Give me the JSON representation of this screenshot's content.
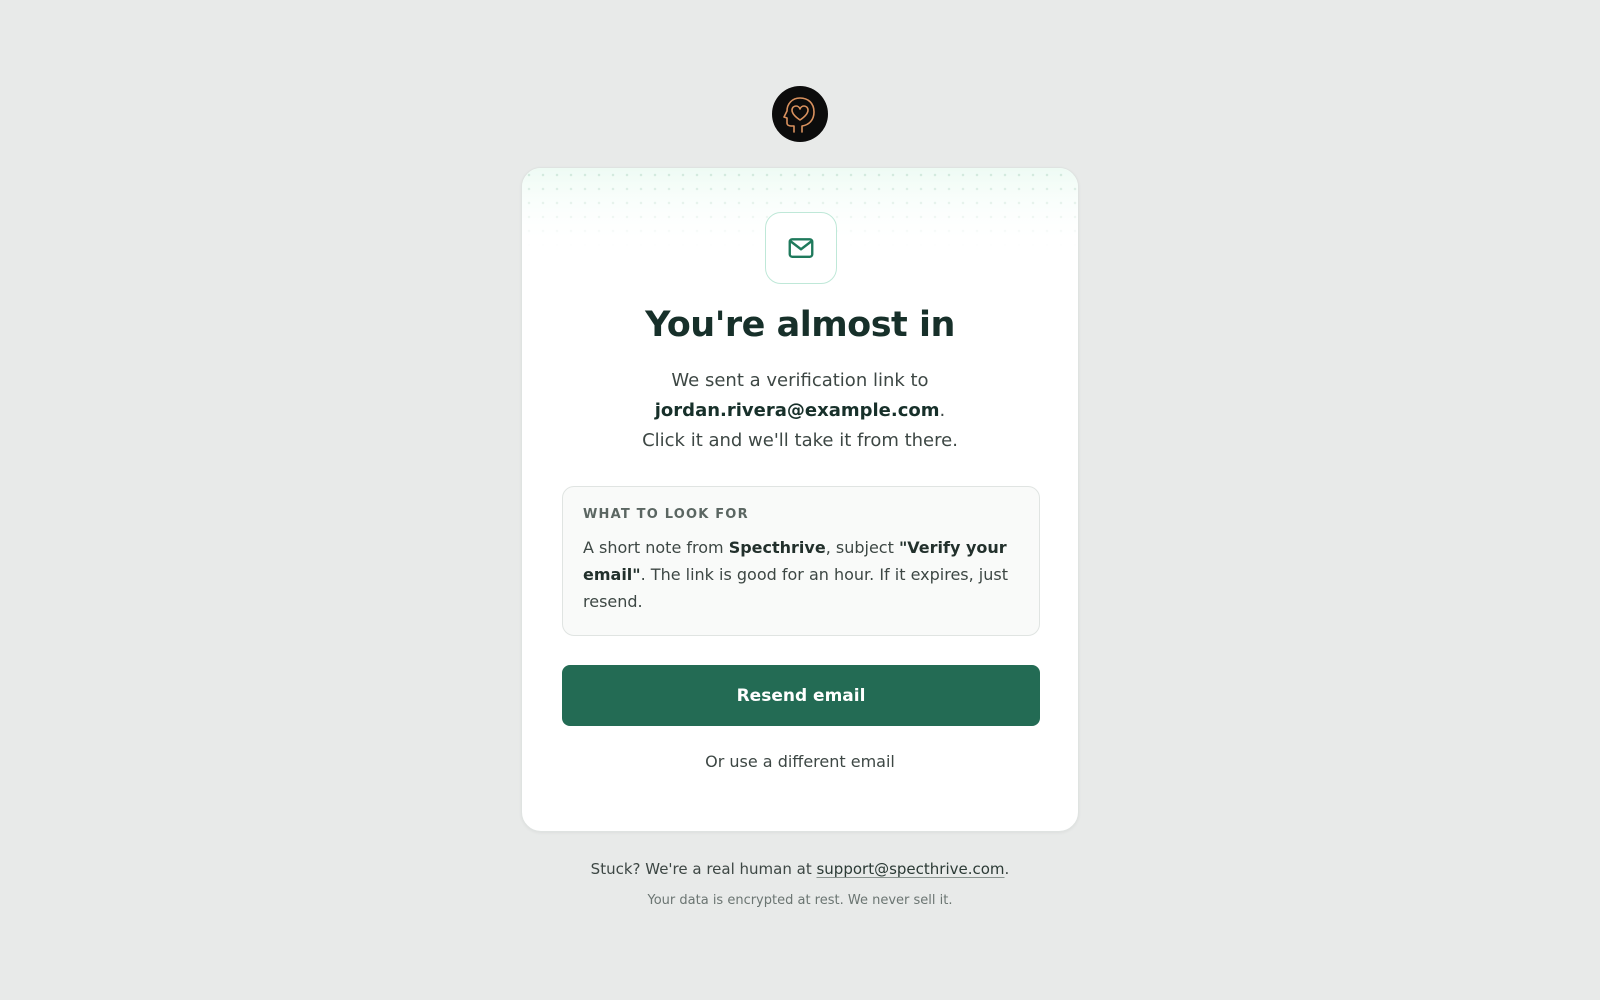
{
  "brand": {
    "logo_icon": "head-heart-icon",
    "accent_color": "#236b54"
  },
  "card": {
    "icon": "envelope-icon",
    "title": "You're almost in",
    "subtitle": {
      "line1": "We sent a verification link to",
      "email": "jordan.rivera@example.com",
      "email_suffix": ".",
      "line3": "Click it and we'll take it from there."
    },
    "look_for": {
      "heading": "WHAT TO LOOK FOR",
      "prefix": "A short note from ",
      "sender": "Specthrive",
      "mid": ", subject ",
      "subject": "\"Verify your email\"",
      "suffix": ". The link is good for an hour. If it expires, just resend."
    },
    "resend_label": "Resend email",
    "alt_email_label": "Or use a different email"
  },
  "footer": {
    "help_prefix": "Stuck? We're a real human at ",
    "support_email": "support@specthrive.com",
    "help_suffix": ".",
    "privacy_note": "Your data is encrypted at rest. We never sell it."
  }
}
